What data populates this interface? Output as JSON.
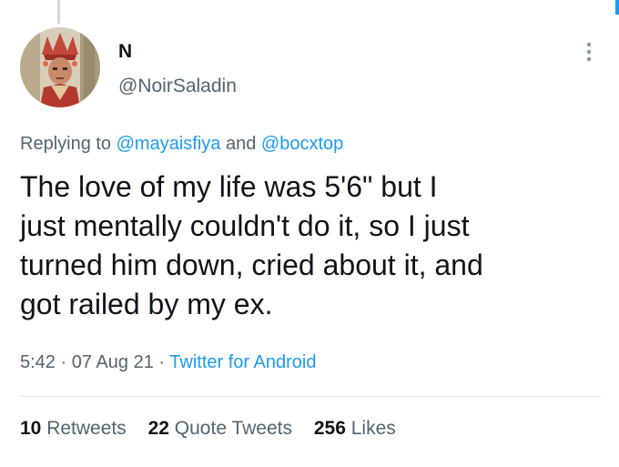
{
  "user": {
    "display_name": "N",
    "handle": "@NoirSaladin"
  },
  "reply": {
    "prefix": "Replying to",
    "mention_1": "@mayaisfiya",
    "joiner": "and",
    "mention_2": "@bocxtop"
  },
  "tweet": {
    "lines": [
      "The love of my life was 5'6\" but I",
      "just mentally couldn't do it, so I just",
      "turned him down, cried about it, and",
      "got railed by my ex."
    ]
  },
  "meta": {
    "time": "5:42",
    "separator": "·",
    "date": "07 Aug 21",
    "source": "Twitter for Android"
  },
  "stats": {
    "retweets_count": "10",
    "retweets_label": "Retweets",
    "quotes_count": "22",
    "quotes_label": "Quote Tweets",
    "likes_count": "256",
    "likes_label": "Likes"
  },
  "icons": {
    "more": "more-vertical-icon"
  },
  "colors": {
    "accent": "#1d9bf0",
    "secondary_text": "#536471",
    "primary_text": "#0f1419"
  }
}
